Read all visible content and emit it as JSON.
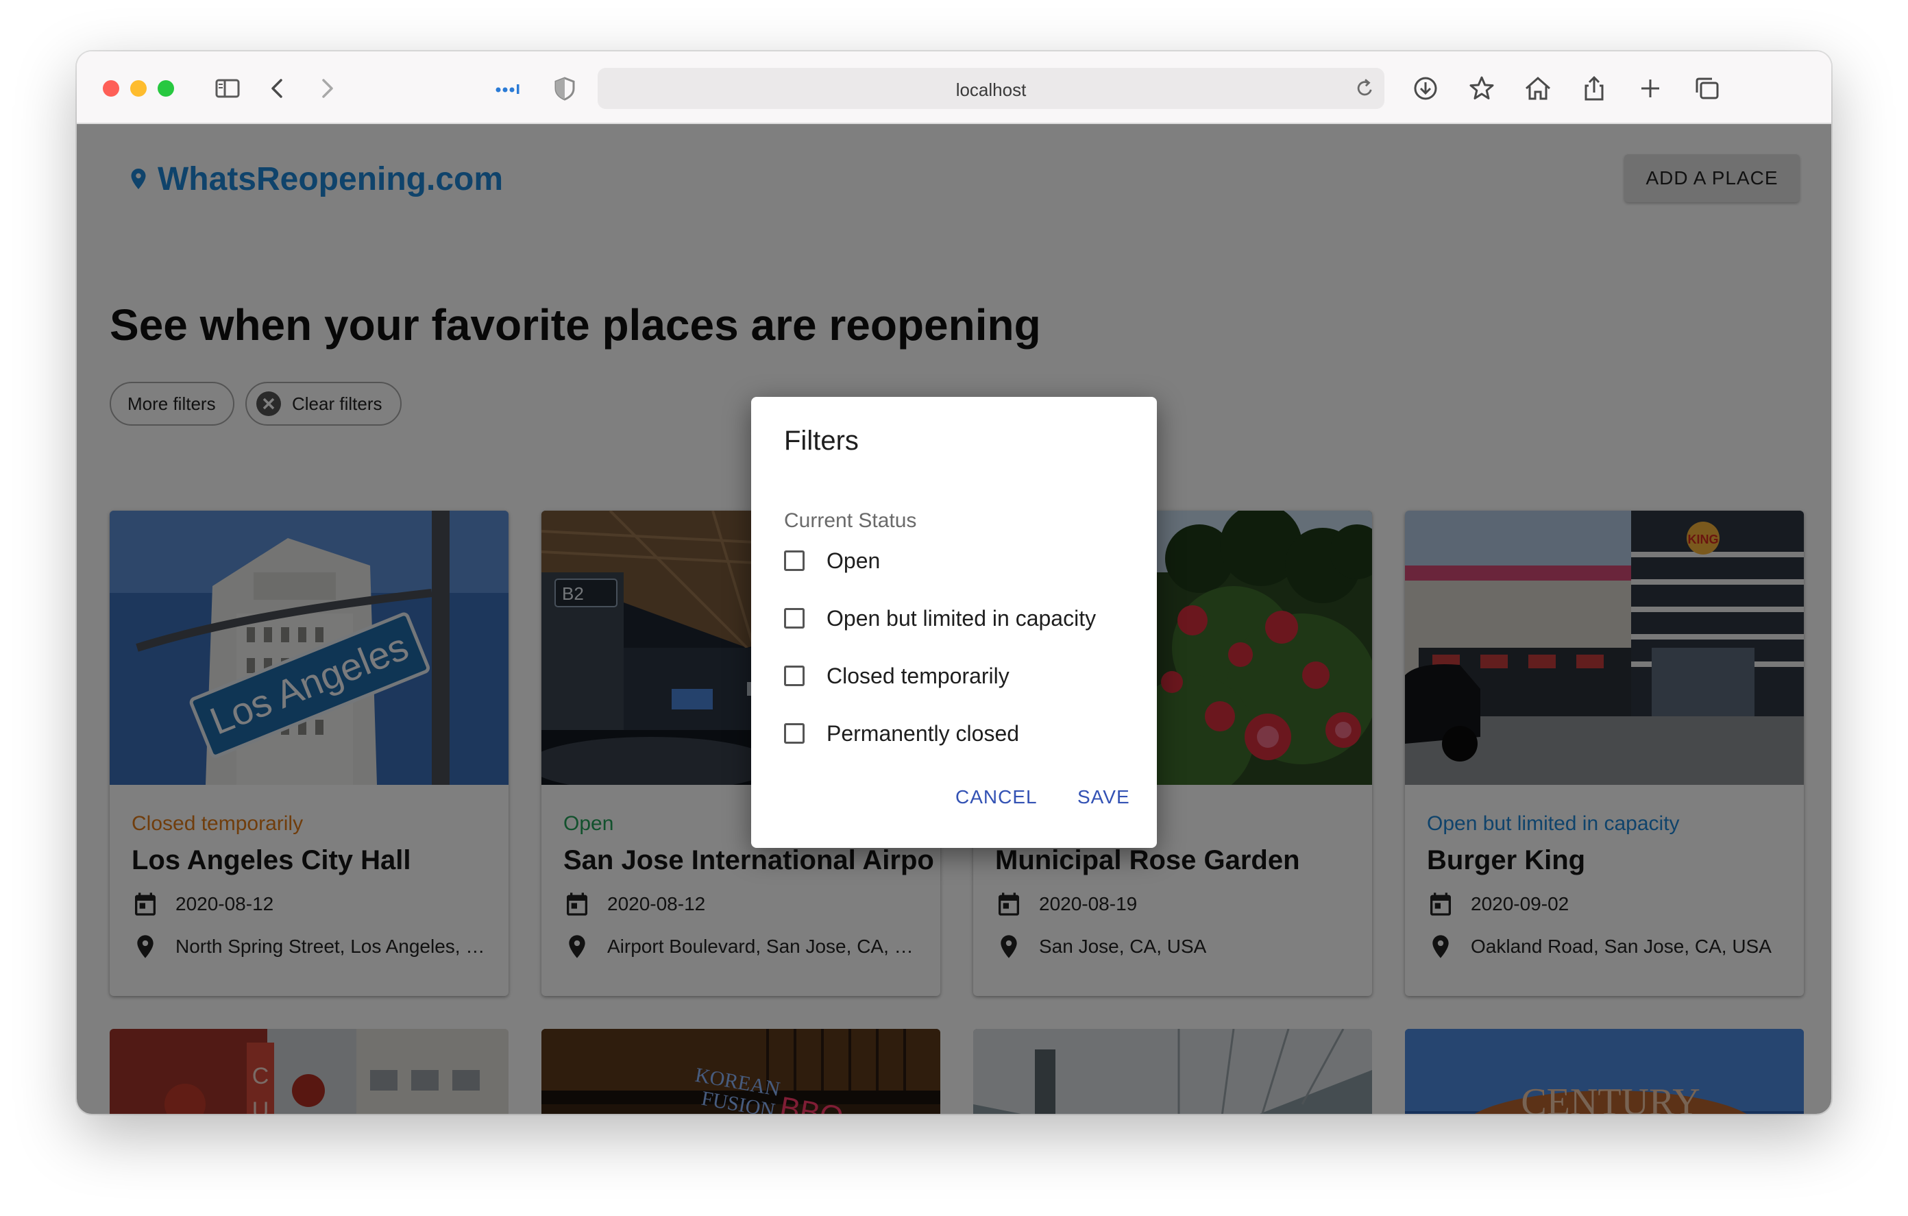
{
  "browser": {
    "url": "localhost"
  },
  "site": {
    "logo_text": "WhatsReopening.com",
    "add_place_label": "ADD A PLACE",
    "headline": "See when your favorite places are reopening",
    "chips": {
      "more_filters": "More filters",
      "clear_filters": "Clear filters"
    }
  },
  "colors": {
    "brand_blue": "#1f87d6",
    "status_closed_temporarily": "#e07b18",
    "status_open": "#25a25a",
    "status_open_limited": "#1f87d6",
    "dialog_button": "#3352b4"
  },
  "cards": [
    {
      "status": "Closed temporarily",
      "status_color": "#e07b18",
      "title": "Los Angeles City Hall",
      "date": "2020-08-12",
      "address": "North Spring Street, Los Angeles, CA, USA",
      "image": "los-angeles-street-sign-photo"
    },
    {
      "status": "Open",
      "status_color": "#25a25a",
      "title": "San Jose International Airport",
      "date": "2020-08-12",
      "address": "Airport Boulevard, San Jose, CA, USA",
      "image": "airport-terminal-photo"
    },
    {
      "status": "",
      "status_color": "#25a25a",
      "title": "Municipal Rose Garden",
      "date": "2020-08-19",
      "address": "San Jose, CA, USA",
      "image": "rose-garden-photo"
    },
    {
      "status": "Open but limited in capacity",
      "status_color": "#1f87d6",
      "title": "Burger King",
      "date": "2020-09-02",
      "address": "Oakland Road, San Jose, CA, USA",
      "image": "burger-king-storefront-photo"
    }
  ],
  "dialog": {
    "title": "Filters",
    "section_label": "Current Status",
    "options": [
      {
        "label": "Open",
        "checked": false
      },
      {
        "label": "Open but limited in capacity",
        "checked": false
      },
      {
        "label": "Closed temporarily",
        "checked": false
      },
      {
        "label": "Permanently closed",
        "checked": false
      }
    ],
    "cancel_label": "CANCEL",
    "save_label": "SAVE"
  }
}
